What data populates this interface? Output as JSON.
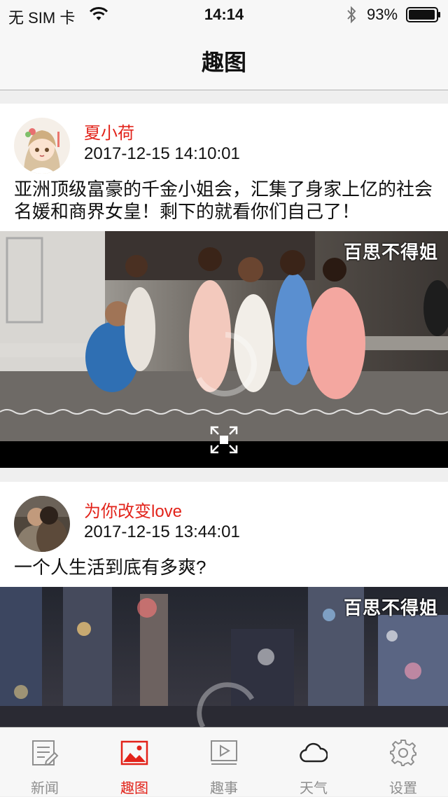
{
  "status_bar": {
    "carrier": "无 SIM 卡",
    "time": "14:14",
    "battery_percent": "93%"
  },
  "navbar": {
    "title": "趣图"
  },
  "posts": [
    {
      "username": "夏小荷",
      "timestamp": "2017-12-15 14:10:01",
      "text": "亚洲顶级富豪的千金小姐会，汇集了身家上亿的社会名媛和商界女皇！剩下的就看你们自己了！",
      "watermark": "百思不得姐"
    },
    {
      "username": "为你改变love",
      "timestamp": "2017-12-15 13:44:01",
      "text": "一个人生活到底有多爽?",
      "watermark": "百思不得姐"
    }
  ],
  "tabbar": {
    "items": [
      {
        "label": "新闻",
        "icon": "news-icon"
      },
      {
        "label": "趣图",
        "icon": "picture-icon"
      },
      {
        "label": "趣事",
        "icon": "video-icon"
      },
      {
        "label": "天气",
        "icon": "cloud-icon"
      },
      {
        "label": "设置",
        "icon": "gear-icon"
      }
    ],
    "active_index": 1
  },
  "colors": {
    "accent": "#e2231a",
    "inactive": "#8e8e8e"
  }
}
